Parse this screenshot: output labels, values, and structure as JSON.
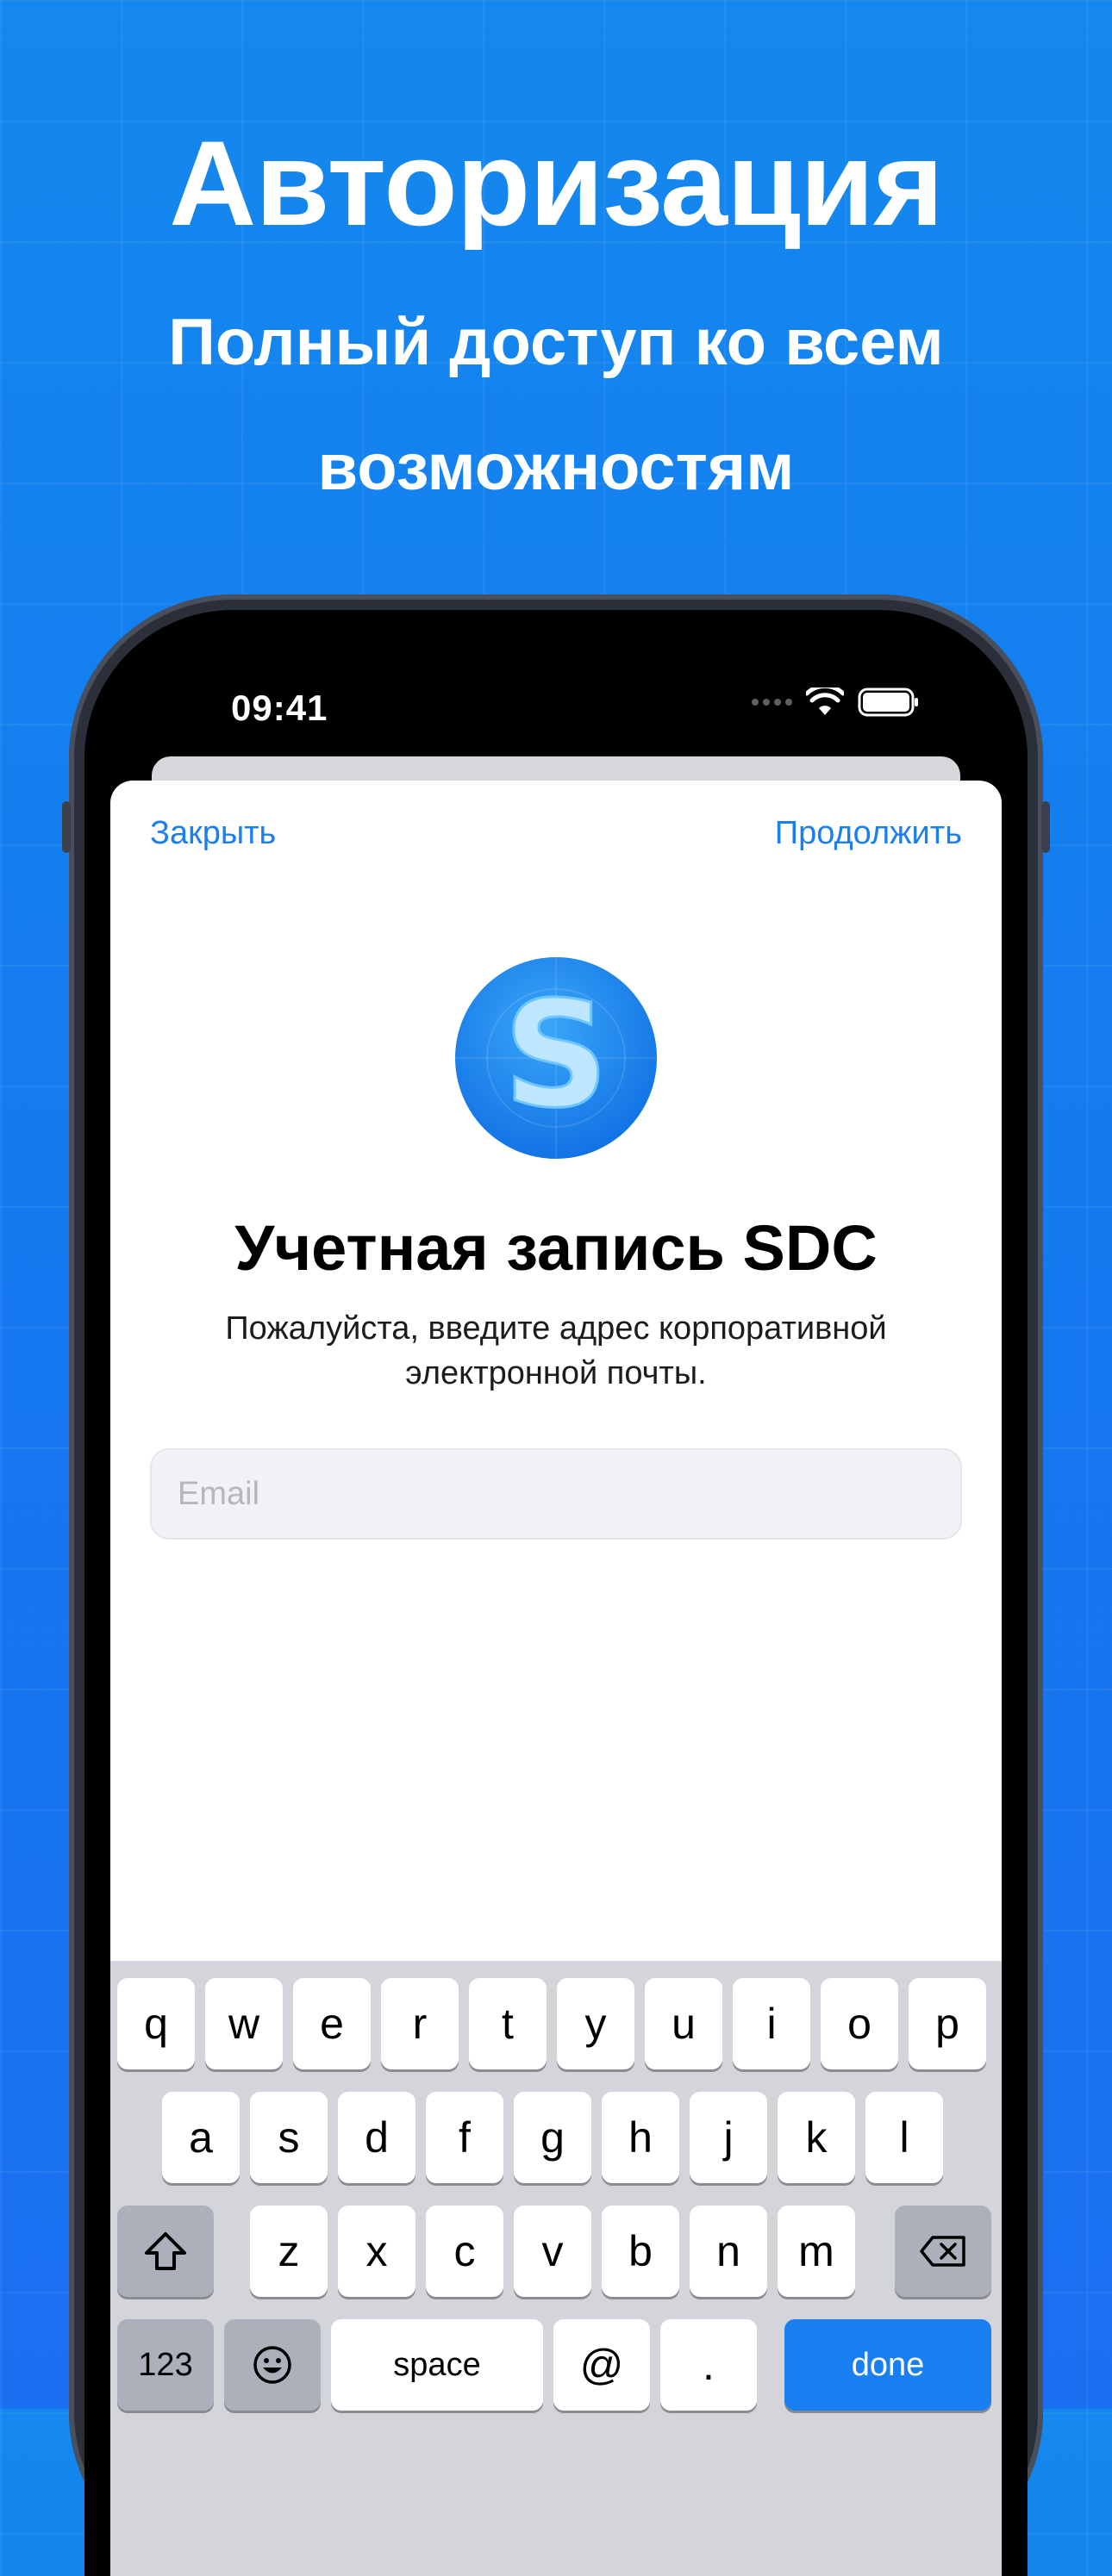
{
  "promo": {
    "headline": "Авторизация",
    "subheadline": "Полный доступ ко всем возможностям"
  },
  "status_bar": {
    "time": "09:41",
    "icons": [
      "signal-icon",
      "wifi-icon",
      "battery-icon"
    ]
  },
  "sheet": {
    "close_label": "Закрыть",
    "continue_label": "Продолжить",
    "logo_letter": "S",
    "title": "Учетная запись SDC",
    "subtitle": "Пожалуйста, введите адрес корпоративной электронной почты.",
    "email_value": "",
    "email_placeholder": "Email"
  },
  "keyboard": {
    "row1": [
      "q",
      "w",
      "e",
      "r",
      "t",
      "y",
      "u",
      "i",
      "o",
      "p"
    ],
    "row2": [
      "a",
      "s",
      "d",
      "f",
      "g",
      "h",
      "j",
      "k",
      "l"
    ],
    "row3": [
      "z",
      "x",
      "c",
      "v",
      "b",
      "n",
      "m"
    ],
    "shift_icon": "shift-icon",
    "delete_icon": "delete-icon",
    "numbers_label": "123",
    "emoji_icon": "emoji-icon",
    "space_label": "space",
    "at_label": "@",
    "dot_label": ".",
    "done_label": "done"
  },
  "colors": {
    "accent": "#1a7ff0",
    "background_top": "#1488ee",
    "background_bottom": "#1a6ff0"
  }
}
